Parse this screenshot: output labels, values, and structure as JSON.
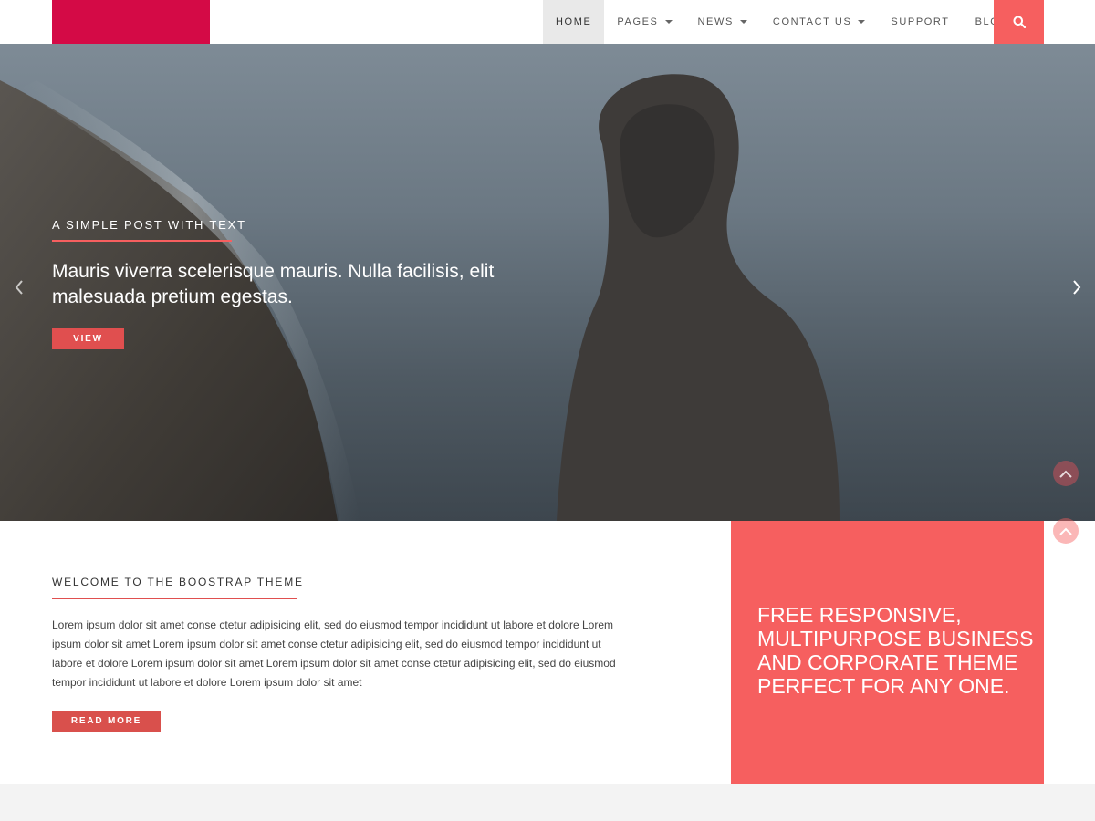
{
  "colors": {
    "logo": "#d40a46",
    "accent": "#f65f5f",
    "button": "#e04f4f",
    "nav_active_bg": "#e9e9e9"
  },
  "header": {
    "nav": [
      {
        "label": "HOME",
        "active": true,
        "dropdown": false
      },
      {
        "label": "PAGES",
        "active": false,
        "dropdown": true
      },
      {
        "label": "NEWS",
        "active": false,
        "dropdown": true
      },
      {
        "label": "CONTACT US",
        "active": false,
        "dropdown": true
      },
      {
        "label": "SUPPORT",
        "active": false,
        "dropdown": false
      },
      {
        "label": "BLOG",
        "active": false,
        "dropdown": false
      }
    ],
    "search_icon": "search-icon"
  },
  "hero": {
    "eyebrow": "A SIMPLE POST WITH TEXT",
    "title": "Mauris viverra scelerisque mauris. Nulla facilisis, elit malesuada pretium egestas.",
    "button_label": "VIEW",
    "prev_icon": "chevron-left-icon",
    "next_icon": "chevron-right-icon"
  },
  "welcome": {
    "title": "WELCOME TO THE BOOSTRAP THEME",
    "text": "Lorem ipsum dolor sit amet conse ctetur adipisicing elit, sed do eiusmod tempor incididunt ut labore et dolore Lorem ipsum dolor sit amet Lorem ipsum dolor sit amet conse ctetur adipisicing elit, sed do eiusmod tempor incididunt ut labore et dolore Lorem ipsum dolor sit amet Lorem ipsum dolor sit amet conse ctetur adipisicing elit, sed do eiusmod tempor incididunt ut labore et dolore Lorem ipsum dolor sit amet",
    "button_label": "READ MORE"
  },
  "promo": {
    "text": "FREE RESPONSIVE, MULTIPURPOSE BUSINESS AND CORPORATE THEME PERFECT FOR ANY ONE."
  }
}
